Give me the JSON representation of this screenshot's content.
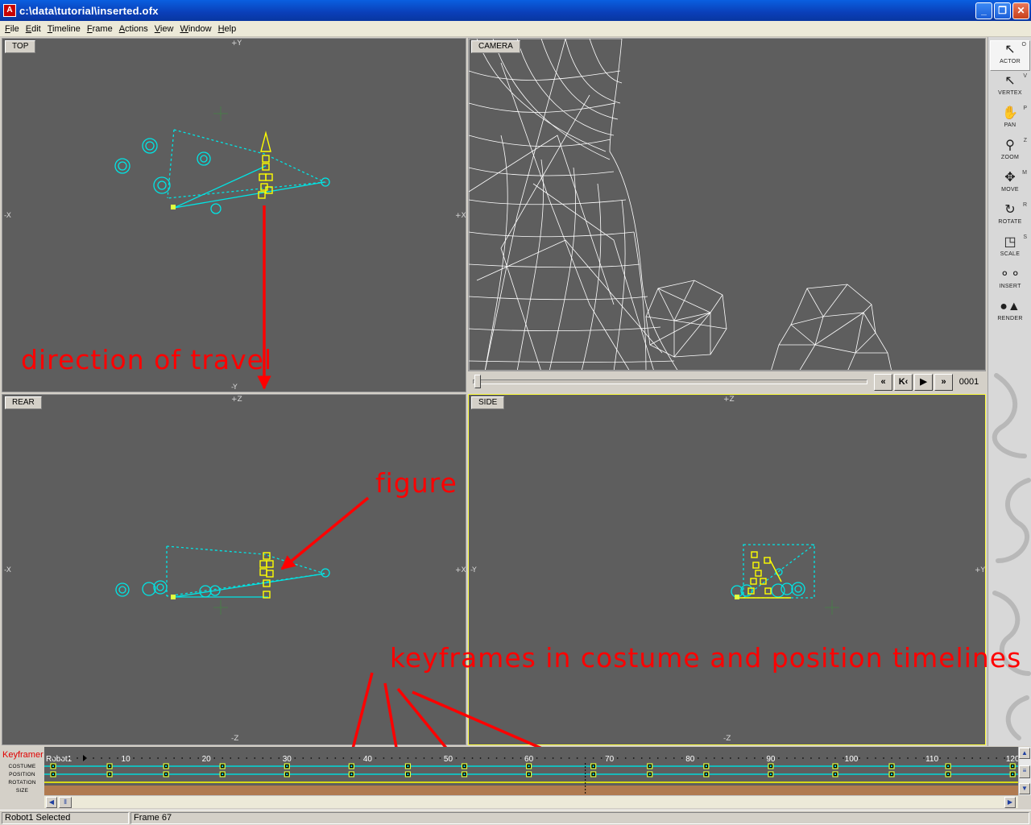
{
  "window": {
    "title": "c:\\data\\tutorial\\inserted.ofx",
    "minimize": "_",
    "maximize": "❐",
    "close": "✕"
  },
  "menu": [
    "File",
    "Edit",
    "Timeline",
    "Frame",
    "Actions",
    "View",
    "Window",
    "Help"
  ],
  "viewports": {
    "top": {
      "label": "TOP",
      "axis_top": "+Y",
      "axis_bottom": "-Y",
      "axis_left": "-X",
      "axis_right": "+X"
    },
    "camera": {
      "label": "CAMERA"
    },
    "rear": {
      "label": "REAR",
      "axis_top": "+Z",
      "axis_bottom": "-Z",
      "axis_left": "-X",
      "axis_right": "+X"
    },
    "side": {
      "label": "SIDE",
      "axis_top": "+Z",
      "axis_bottom": "-Z",
      "axis_left": "-Y",
      "axis_right": "+Y"
    }
  },
  "camera_controls": {
    "first": "«",
    "prev_key": "K‹",
    "play": "▶",
    "last": "»",
    "frame": "0001"
  },
  "toolbar": [
    {
      "label": "ACTOR",
      "key": "O",
      "icon": "arrow-icon",
      "glyph": "↖",
      "active": true
    },
    {
      "label": "VERTEX",
      "key": "V",
      "icon": "vertex-arrow-icon",
      "glyph": "↖",
      "active": false
    },
    {
      "label": "PAN",
      "key": "P",
      "icon": "hand-icon",
      "glyph": "✋",
      "active": false
    },
    {
      "label": "ZOOM",
      "key": "Z",
      "icon": "magnifier-icon",
      "glyph": "⚲",
      "active": false
    },
    {
      "label": "MOVE",
      "key": "M",
      "icon": "move-icon",
      "glyph": "✥",
      "active": false
    },
    {
      "label": "ROTATE",
      "key": "R",
      "icon": "rotate-icon",
      "glyph": "↻",
      "active": false
    },
    {
      "label": "SCALE",
      "key": "S",
      "icon": "scale-icon",
      "glyph": "◳",
      "active": false
    },
    {
      "label": "INSERT",
      "key": "",
      "icon": "insert-icon",
      "glyph": "⚬⚬",
      "active": false
    },
    {
      "label": "RENDER",
      "key": "",
      "icon": "render-icon",
      "glyph": "●▲",
      "active": false
    }
  ],
  "annotations": {
    "direction": "direction of travel",
    "figure": "figure",
    "keyframes": "keyframes in costume and position timelines"
  },
  "keyframer": {
    "title": "Keyframer",
    "actor": "Robot1",
    "tracks": [
      "COSTUME",
      "POSITION",
      "ROTATION",
      "SIZE"
    ],
    "ticks": [
      10,
      20,
      30,
      40,
      50,
      60,
      70,
      80,
      90,
      100,
      110,
      120
    ],
    "keyframes": [
      1,
      8,
      15,
      22,
      30,
      38,
      45,
      52,
      60,
      68,
      75,
      82,
      90,
      98,
      105,
      112,
      120
    ],
    "current_frame": 67
  },
  "status": {
    "selection": "Robot1 Selected",
    "frame": "Frame 67"
  },
  "colors": {
    "viewport_bg": "#5e5e5e",
    "cyan": "#00e5e5",
    "yellow": "#ffff00",
    "annotation_red": "#ff0000",
    "selected_border": "#ffff40"
  }
}
